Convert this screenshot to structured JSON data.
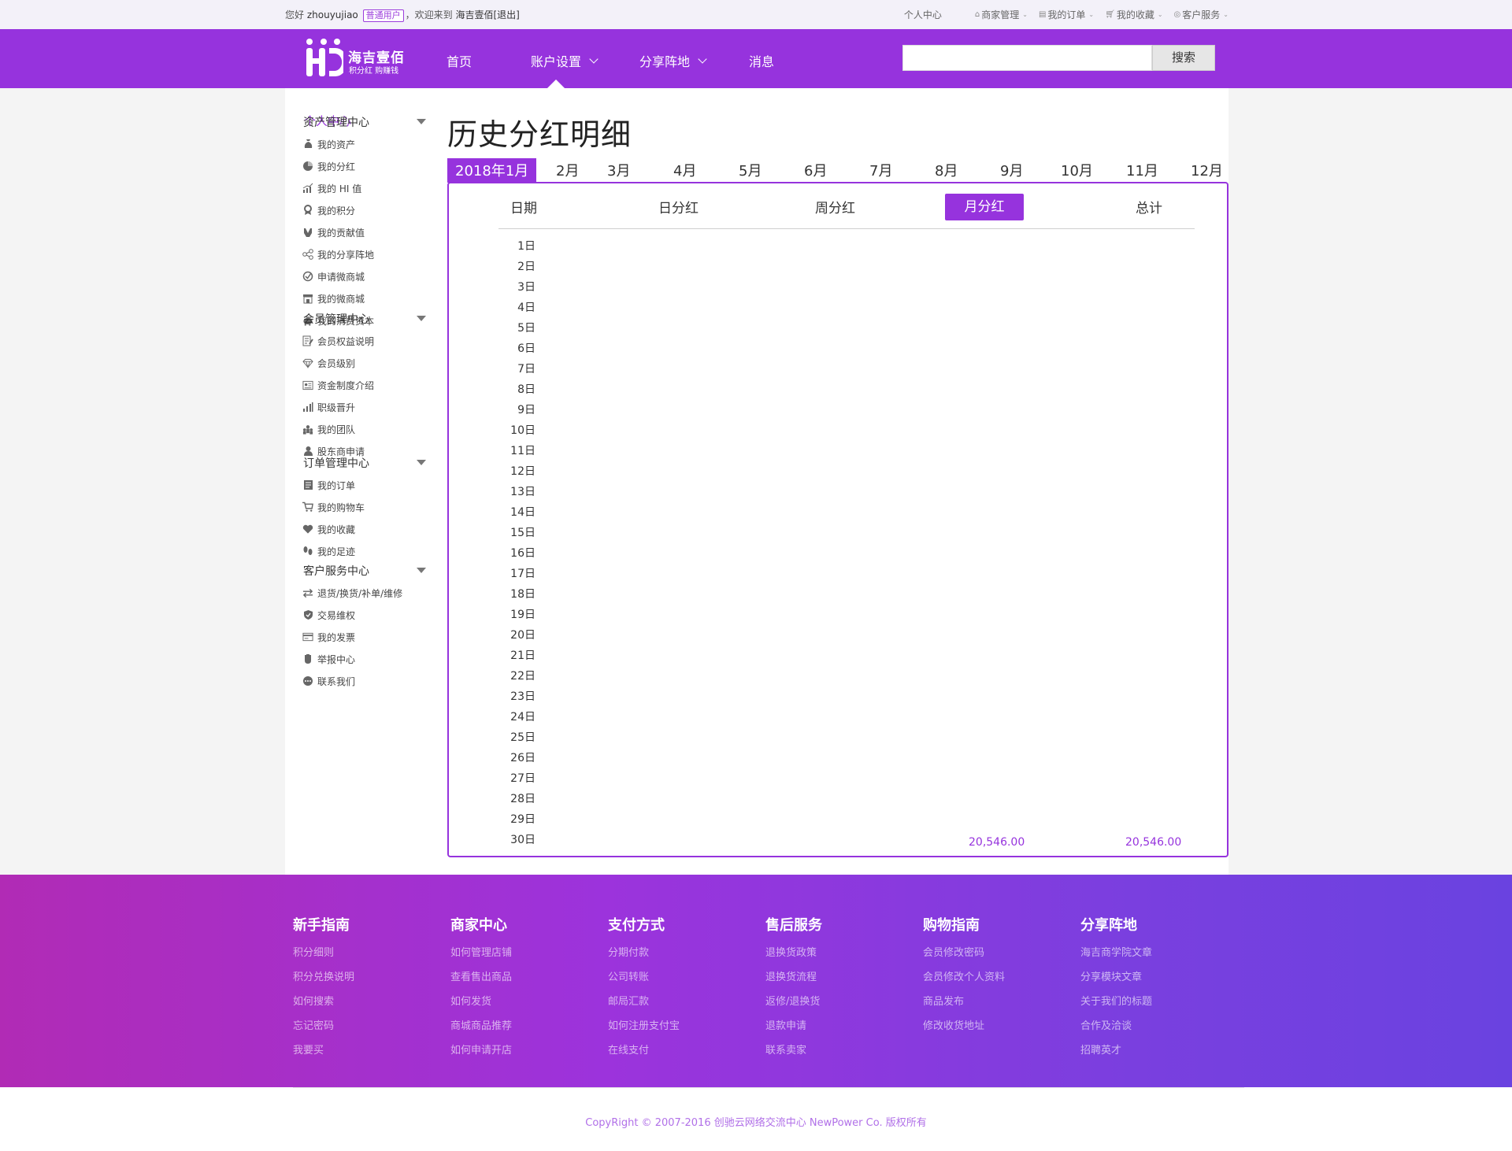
{
  "topbar": {
    "greeting": "您好",
    "username": "zhouyujiao",
    "role": "普通用户",
    "welcome": "，欢迎来到",
    "site_name": "海吉壹佰",
    "logout": "[退出]",
    "links": [
      {
        "label": "个人中心",
        "icon": "",
        "caret": false
      },
      {
        "label": "商家管理",
        "icon": "home-icon",
        "caret": true
      },
      {
        "label": "我的订单",
        "icon": "list-icon",
        "caret": true
      },
      {
        "label": "我的收藏",
        "icon": "cart-icon",
        "caret": true
      },
      {
        "label": "客户服务",
        "icon": "headset-icon",
        "caret": true
      }
    ]
  },
  "logo": {
    "title": "海吉壹佰",
    "slogan": "积分红 购赚钱"
  },
  "nav": {
    "items": [
      "首页",
      "账户设置",
      "分享阵地",
      "消息"
    ],
    "active": "账户设置",
    "search_placeholder": "",
    "search_button": "搜索"
  },
  "sidebar": {
    "home": "个人中心",
    "sections": [
      {
        "title": "资产管理中心",
        "items": [
          {
            "label": "我的资产",
            "icon": "money-bag-icon"
          },
          {
            "label": "我的分红",
            "icon": "pie-icon"
          },
          {
            "label": "我的 HI 值",
            "icon": "trend-icon"
          },
          {
            "label": "我的积分",
            "icon": "medal-icon"
          },
          {
            "label": "我的贡献值",
            "icon": "hands-icon"
          },
          {
            "label": "我的分享阵地",
            "icon": "share-icon"
          },
          {
            "label": "申请微商城",
            "icon": "check-circle-icon"
          },
          {
            "label": "我的微商城",
            "icon": "store-icon"
          },
          {
            "label": "我的消费资本",
            "icon": "piggy-bank-icon"
          }
        ]
      },
      {
        "title": "会员管理中心",
        "items": [
          {
            "label": "会员权益说明",
            "icon": "doc-edit-icon"
          },
          {
            "label": "会员级别",
            "icon": "diamond-icon"
          },
          {
            "label": "资金制度介绍",
            "icon": "id-card-icon"
          },
          {
            "label": "职级晋升",
            "icon": "bar-rise-icon"
          },
          {
            "label": "我的团队",
            "icon": "team-icon"
          },
          {
            "label": "股东商申请",
            "icon": "user-icon"
          }
        ]
      },
      {
        "title": "订单管理中心",
        "items": [
          {
            "label": "我的订单",
            "icon": "order-icon"
          },
          {
            "label": "我的购物车",
            "icon": "cart-icon"
          },
          {
            "label": "我的收藏",
            "icon": "heart-icon"
          },
          {
            "label": "我的足迹",
            "icon": "footprint-icon"
          }
        ]
      },
      {
        "title": "客户服务中心",
        "items": [
          {
            "label": "退货/换货/补单/维修",
            "icon": "swap-icon"
          },
          {
            "label": "交易维权",
            "icon": "shield-icon"
          },
          {
            "label": "我的发票",
            "icon": "invoice-icon"
          },
          {
            "label": "举报中心",
            "icon": "hand-icon"
          },
          {
            "label": "联系我们",
            "icon": "chat-icon"
          }
        ]
      }
    ]
  },
  "main": {
    "title": "历史分红明细",
    "months": [
      "2018年1月",
      "2月",
      "3月",
      "4月",
      "5月",
      "6月",
      "7月",
      "8月",
      "9月",
      "10月",
      "11月",
      "12月"
    ],
    "active_month": "2018年1月",
    "columns": [
      "日期",
      "日分红",
      "周分红",
      "月分红",
      "总计"
    ],
    "active_column": "月分红",
    "days": [
      "1日",
      "2日",
      "3日",
      "4日",
      "5日",
      "6日",
      "7日",
      "8日",
      "9日",
      "10日",
      "11日",
      "12日",
      "13日",
      "14日",
      "15日",
      "16日",
      "17日",
      "18日",
      "19日",
      "20日",
      "21日",
      "22日",
      "23日",
      "24日",
      "25日",
      "26日",
      "27日",
      "28日",
      "29日",
      "30日"
    ],
    "last_row": {
      "month_dividend": "20,546.00",
      "total": "20,546.00"
    }
  },
  "footer": {
    "columns": [
      {
        "title": "新手指南",
        "links": [
          "积分细则",
          "积分兑换说明",
          "如何搜索",
          "忘记密码",
          "我要买"
        ]
      },
      {
        "title": "商家中心",
        "links": [
          "如何管理店铺",
          "查看售出商品",
          "如何发货",
          "商城商品推荐",
          "如何申请开店"
        ]
      },
      {
        "title": "支付方式",
        "links": [
          "分期付款",
          "公司转账",
          "邮局汇款",
          "如何注册支付宝",
          "在线支付"
        ]
      },
      {
        "title": "售后服务",
        "links": [
          "退换货政策",
          "退换货流程",
          "返修/退换货",
          "退款申请",
          "联系卖家"
        ]
      },
      {
        "title": "购物指南",
        "links": [
          "会员修改密码",
          "会员修改个人资料",
          "商品发布",
          "修改收货地址"
        ]
      },
      {
        "title": "分享阵地",
        "links": [
          "海吉商学院文章",
          "分享模块文章",
          "关于我们的标题",
          "合作及洽谈",
          "招聘英才"
        ]
      }
    ],
    "copyright": "CopyRight © 2007-2016 创驰云网络交流中心 NewPower Co. 版权所有"
  },
  "colors": {
    "brand": "#9633dd",
    "link": "#9633dd"
  }
}
